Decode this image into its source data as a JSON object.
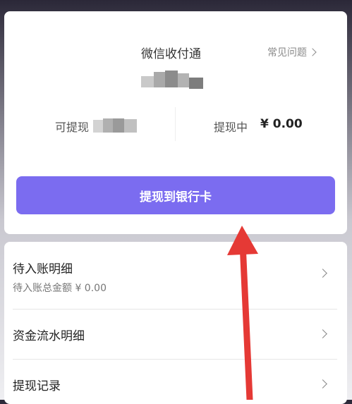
{
  "header": {
    "title": "微信收付通",
    "faq_label": "常见问题"
  },
  "balances": {
    "available_label": "可提现",
    "pending_label": "提现中",
    "pending_amount": "¥ 0.00"
  },
  "actions": {
    "withdraw_label": "提现到银行卡"
  },
  "menu": [
    {
      "title": "待入账明细",
      "subtitle": "待入账总金额 ¥ 0.00"
    },
    {
      "title": "资金流水明细",
      "subtitle": ""
    },
    {
      "title": "提现记录",
      "subtitle": ""
    }
  ],
  "colors": {
    "primary_button": "#7b6cf0",
    "annotation_arrow": "#e53935"
  },
  "icons": {
    "faq": "chevron-right-icon",
    "row": "chevron-right-icon",
    "annotation": "red-arrow-icon"
  }
}
